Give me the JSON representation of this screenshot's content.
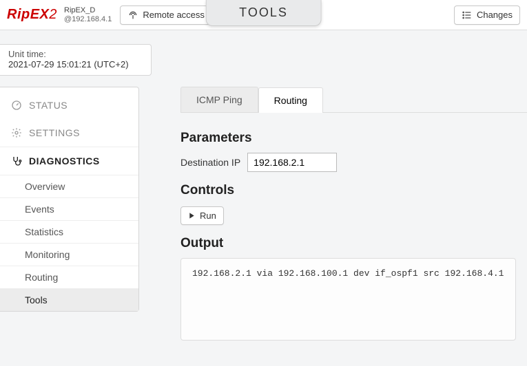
{
  "header": {
    "logo_main": "RipEX",
    "logo_suffix": "2",
    "unit_name": "RipEX_D",
    "unit_ip": "@192.168.4.1",
    "remote_access_label": "Remote access",
    "page_title": "TOOLS",
    "changes_label": "Changes"
  },
  "time": {
    "label": "Unit time:",
    "value": "2021-07-29 15:01:21 (UTC+2)"
  },
  "sidebar": {
    "status_label": "STATUS",
    "settings_label": "SETTINGS",
    "diagnostics_label": "DIAGNOSTICS",
    "subs": {
      "overview": "Overview",
      "events": "Events",
      "statistics": "Statistics",
      "monitoring": "Monitoring",
      "routing": "Routing",
      "tools": "Tools"
    }
  },
  "tabs": {
    "icmp_ping": "ICMP Ping",
    "routing": "Routing"
  },
  "parameters": {
    "heading": "Parameters",
    "dest_ip_label": "Destination IP",
    "dest_ip_value": "192.168.2.1"
  },
  "controls": {
    "heading": "Controls",
    "run_label": "Run"
  },
  "output": {
    "heading": "Output",
    "text": "192.168.2.1 via 192.168.100.1 dev if_ospf1 src 192.168.4.1"
  }
}
